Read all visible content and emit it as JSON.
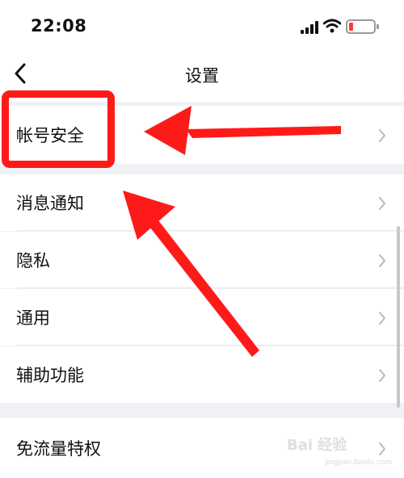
{
  "status_bar": {
    "time": "22:08",
    "icons": [
      "signal-icon",
      "wifi-icon",
      "battery-low-icon"
    ]
  },
  "nav": {
    "title": "设置",
    "back_icon": "chevron-left-icon"
  },
  "settings": {
    "items": [
      {
        "label": "帐号安全",
        "icon": "chevron-right-icon"
      },
      {
        "label": "消息通知",
        "icon": "chevron-right-icon"
      },
      {
        "label": "隐私",
        "icon": "chevron-right-icon"
      },
      {
        "label": "通用",
        "icon": "chevron-right-icon"
      },
      {
        "label": "辅助功能",
        "icon": "chevron-right-icon"
      },
      {
        "label": "免流量特权",
        "icon": "chevron-right-icon"
      }
    ]
  },
  "annotation": {
    "color": "#ff1a1a"
  },
  "watermark": {
    "text": "Bai 经验",
    "sub": "jingyan.baidu.com"
  }
}
